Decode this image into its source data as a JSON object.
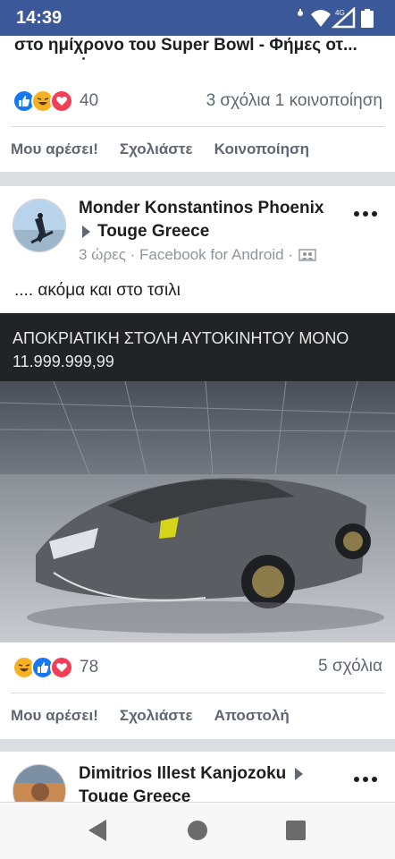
{
  "status_bar": {
    "time": "14:39",
    "network": "4G",
    "icons": [
      "alarm-icon",
      "wifi-icon",
      "signal-icon",
      "battery-icon"
    ]
  },
  "post1": {
    "title_snippet": "στο ημίχρονο του Super Bowl - Φήμες οτ...",
    "reactions": [
      "like",
      "haha",
      "love"
    ],
    "reaction_count": "40",
    "stats": "3 σχόλια   1 κοινοποίηση",
    "actions": {
      "like": "Μου αρέσει!",
      "comment": "Σχολιάστε",
      "share": "Κοινοποίηση"
    }
  },
  "post2": {
    "author": "Monder Konstantinos Phoenix",
    "group": "Touge Greece",
    "meta": "3 ώρες · Facebook for Android ·",
    "text": ".... ακόμα και στο τσιλι",
    "image_caption_line1": "ΑΠΟΚΡΙΑΤΙΚΗ ΣΤΟΛΗ ΑΥΤΟΚΙΝΗΤΟΥ ΜΟΝΟ",
    "image_caption_line2": "11.999.999,99",
    "reactions": [
      "haha",
      "like",
      "love"
    ],
    "reaction_count": "78",
    "stats": "5 σχόλια",
    "actions": {
      "like": "Μου αρέσει!",
      "comment": "Σχολιάστε",
      "send": "Αποστολή"
    }
  },
  "post3": {
    "author": "Dimitrios Illest Kanjozoku",
    "group": "Touge Greece"
  },
  "nav": {
    "buttons": [
      "back-icon",
      "home-icon",
      "recents-icon"
    ]
  },
  "colors": {
    "facebook_blue": "#3b5998",
    "like_blue": "#1877f2",
    "love_red": "#f33e58",
    "haha_yellow": "#f7b125"
  }
}
